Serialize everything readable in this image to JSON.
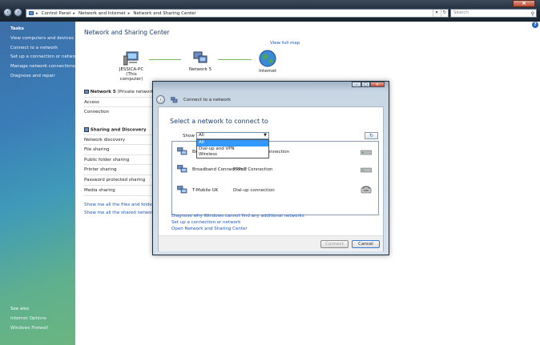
{
  "address": {
    "crumbs": [
      "Control Panel",
      "Network and Internet",
      "Network and Sharing Center"
    ],
    "search_placeholder": "Search"
  },
  "sidebar": {
    "tasks_heading": "Tasks",
    "tasks": [
      "View computers and devices",
      "Connect to a network",
      "Set up a connection or network",
      "Manage network connections",
      "Diagnose and repair"
    ],
    "see_also_heading": "See also",
    "see_also": [
      "Internet Options",
      "Windows Firewall"
    ]
  },
  "main": {
    "title": "Network and Sharing Center",
    "view_full_map": "View full map",
    "map": {
      "computer": "JESSICA-PC",
      "computer_sub": "(This computer)",
      "network": "Network  5",
      "internet": "Internet"
    },
    "network_row": {
      "name": "Network  5",
      "type": "(Private network)"
    },
    "rows_a": [
      "Access",
      "Connection"
    ],
    "sharing_heading": "Sharing and Discovery",
    "rows_b": [
      "Network discovery",
      "File sharing",
      "Public folder sharing",
      "Printer sharing",
      "Password protected sharing",
      "Media sharing"
    ],
    "links": [
      "Show me all the files and folders I",
      "Show me all the shared network fo"
    ]
  },
  "dialog": {
    "title": "Connect to a network",
    "heading": "Select a network to connect to",
    "show_label": "Show",
    "show_value": "All",
    "show_options": [
      "All",
      "Dial-up and VPN",
      "Wireless"
    ],
    "networks": [
      {
        "name": "Br",
        "type": "Connection",
        "device": "modem-icon"
      },
      {
        "name": "Broadband Connection 2",
        "type": "PPPoE Connection",
        "device": "modem-icon"
      },
      {
        "name": "T-Mobile UK",
        "type": "Dial-up connection",
        "device": "phone-icon"
      }
    ],
    "links": [
      "Diagnose why Windows cannot find any additional networks",
      "Set up a connection or network",
      "Open Network and Sharing Center"
    ],
    "connect_label": "Connect",
    "cancel_label": "Cancel"
  }
}
